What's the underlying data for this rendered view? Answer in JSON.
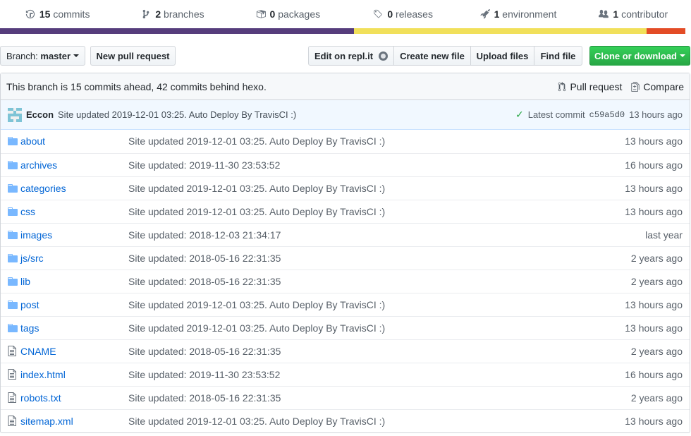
{
  "summary": {
    "commits": {
      "count": "15",
      "label": "commits"
    },
    "branches": {
      "count": "2",
      "label": "branches"
    },
    "packages": {
      "count": "0",
      "label": "packages"
    },
    "releases": {
      "count": "0",
      "label": "releases"
    },
    "environment": {
      "count": "1",
      "label": "environment"
    },
    "contributor": {
      "count": "1",
      "label": "contributor"
    }
  },
  "language_colors": [
    "#563d7c",
    "#f1e05a",
    "#e34c26"
  ],
  "language_fractions": [
    0.516,
    0.427,
    0.057
  ],
  "toolbar": {
    "branch_label": "Branch:",
    "branch_name": "master",
    "new_pr": "New pull request",
    "edit_repl": "Edit on repl.it",
    "create_file": "Create new file",
    "upload_files": "Upload files",
    "find_file": "Find file",
    "clone": "Clone or download"
  },
  "branch_info": {
    "text": "This branch is 15 commits ahead, 42 commits behind hexo.",
    "pull_request": "Pull request",
    "compare": "Compare"
  },
  "commit": {
    "author": "Eccon",
    "message": "Site updated 2019-12-01 03:25. Auto Deploy By TravisCI :)",
    "latest_label": "Latest commit",
    "sha": "c59a5d0",
    "age": "13 hours ago"
  },
  "files": [
    {
      "type": "folder",
      "name": "about",
      "message": "Site updated 2019-12-01 03:25. Auto Deploy By TravisCI :)",
      "age": "13 hours ago"
    },
    {
      "type": "folder",
      "name": "archives",
      "message": "Site updated: 2019-11-30 23:53:52",
      "age": "16 hours ago"
    },
    {
      "type": "folder",
      "name": "categories",
      "message": "Site updated 2019-12-01 03:25. Auto Deploy By TravisCI :)",
      "age": "13 hours ago"
    },
    {
      "type": "folder",
      "name": "css",
      "message": "Site updated 2019-12-01 03:25. Auto Deploy By TravisCI :)",
      "age": "13 hours ago"
    },
    {
      "type": "folder",
      "name": "images",
      "message": "Site updated: 2018-12-03 21:34:17",
      "age": "last year"
    },
    {
      "type": "folder",
      "name": "js/src",
      "message": "Site updated: 2018-05-16 22:31:35",
      "age": "2 years ago"
    },
    {
      "type": "folder",
      "name": "lib",
      "message": "Site updated: 2018-05-16 22:31:35",
      "age": "2 years ago"
    },
    {
      "type": "folder",
      "name": "post",
      "message": "Site updated 2019-12-01 03:25. Auto Deploy By TravisCI :)",
      "age": "13 hours ago"
    },
    {
      "type": "folder",
      "name": "tags",
      "message": "Site updated 2019-12-01 03:25. Auto Deploy By TravisCI :)",
      "age": "13 hours ago"
    },
    {
      "type": "file",
      "name": "CNAME",
      "message": "Site updated: 2018-05-16 22:31:35",
      "age": "2 years ago"
    },
    {
      "type": "file",
      "name": "index.html",
      "message": "Site updated: 2019-11-30 23:53:52",
      "age": "16 hours ago"
    },
    {
      "type": "file",
      "name": "robots.txt",
      "message": "Site updated: 2018-05-16 22:31:35",
      "age": "2 years ago"
    },
    {
      "type": "file",
      "name": "sitemap.xml",
      "message": "Site updated 2019-12-01 03:25. Auto Deploy By TravisCI :)",
      "age": "13 hours ago"
    }
  ]
}
